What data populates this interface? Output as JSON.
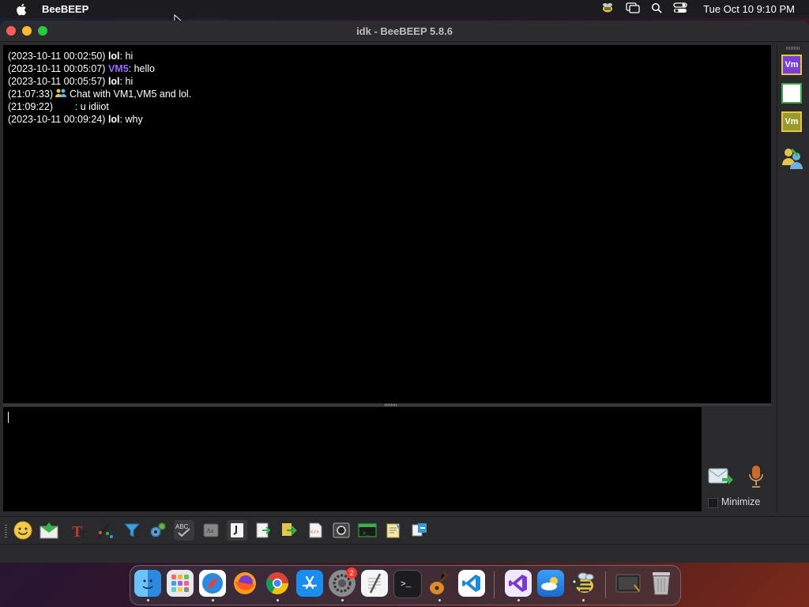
{
  "menubar": {
    "app_name": "BeeBEEP",
    "clock": "Tue Oct 10  9:10 PM",
    "icons": [
      "apple-icon",
      "beebeep-tray-icon",
      "screen-mirroring-icon",
      "spotlight-search-icon",
      "control-center-icon"
    ]
  },
  "window": {
    "title": "idk - BeeBEEP 5.8.6"
  },
  "chat": {
    "lines": [
      {
        "time": "(2023-10-11 00:02:50)",
        "user": "lol",
        "text": ": hi"
      },
      {
        "time": "(2023-10-11 00:05:07)",
        "user": "VM5",
        "text": ": hello"
      },
      {
        "time": "(2023-10-11 00:05:57)",
        "user": "lol",
        "text": ": hi"
      },
      {
        "time": "(21:07:33)",
        "user": "",
        "text": " Chat with VM1,VM5 and lol."
      },
      {
        "time": "(21:09:22)",
        "user": "",
        "text": "        : u idiiot"
      },
      {
        "time": "(2023-10-11 00:09:24)",
        "user": "lol",
        "text": ": why"
      }
    ]
  },
  "compose": {
    "minimize_label": "Minimize"
  },
  "userlist": {
    "items": [
      "Vm",
      "",
      "Vm"
    ]
  },
  "colors": {
    "vm5_user": "#9b6bff",
    "chat_bg": "#000000"
  },
  "toolbar": {
    "icons": [
      "emoticon-icon",
      "send-file-icon",
      "font-icon",
      "color-icon",
      "filter-icon",
      "settings-gear-icon",
      "spellcheck-icon",
      "dictionary-icon",
      "shortcut-icon",
      "save-chat-icon",
      "export-icon",
      "html-icon",
      "screenshot-icon",
      "terminal-icon",
      "notes-icon",
      "share-icon"
    ]
  },
  "dock": {
    "apps": [
      "finder",
      "launchpad",
      "safari",
      "firefox",
      "chrome",
      "app-store",
      "system-settings",
      "textedit",
      "terminal",
      "garageband",
      "vscode",
      "visual-studio",
      "weather",
      "beebeep",
      "screenshot",
      "trash"
    ],
    "settings_badge": "2"
  }
}
